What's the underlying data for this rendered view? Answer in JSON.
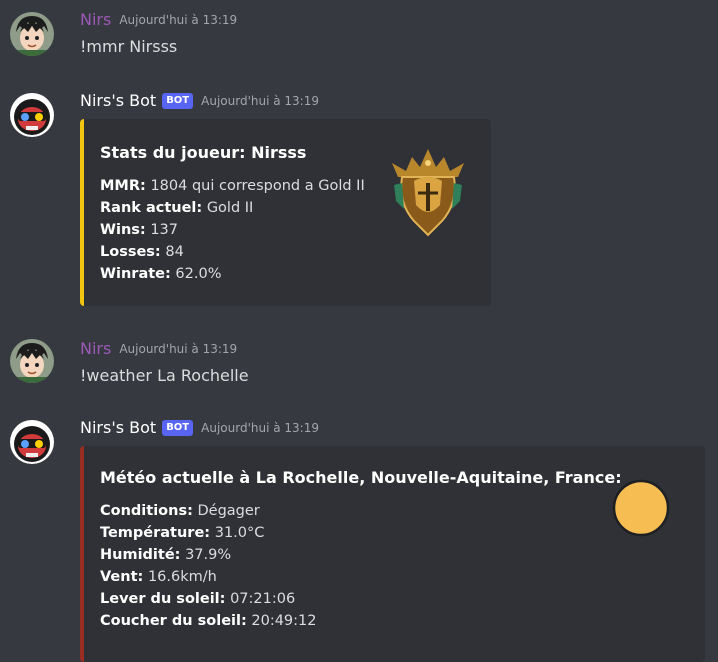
{
  "messages": [
    {
      "author": "Nirs",
      "timestamp": "Aujourd'hui à 13:19",
      "text": "!mmr Nirsss"
    },
    {
      "author": "Nirs's Bot",
      "bot_tag": "BOT",
      "timestamp": "Aujourd'hui à 13:19",
      "embed": {
        "accent_color": "#f1c40f",
        "title": "Stats du joueur: Nirsss",
        "fields": [
          {
            "label": "MMR:",
            "value": "1804 qui correspond a Gold II"
          },
          {
            "label": "Rank actuel:",
            "value": "Gold II"
          },
          {
            "label": "Wins:",
            "value": "137"
          },
          {
            "label": "Losses:",
            "value": "84"
          },
          {
            "label": "Winrate:",
            "value": "62.0%"
          }
        ],
        "thumbnail_icon": "gold-rank-emblem-icon"
      }
    },
    {
      "author": "Nirs",
      "timestamp": "Aujourd'hui à 13:19",
      "text": "!weather La Rochelle"
    },
    {
      "author": "Nirs's Bot",
      "bot_tag": "BOT",
      "timestamp": "Aujourd'hui à 13:19",
      "embed": {
        "accent_color": "#992d22",
        "title": "Météo actuelle à La Rochelle, Nouvelle-Aquitaine, France:",
        "fields": [
          {
            "label": "Conditions:",
            "value": "Dégager"
          },
          {
            "label": "Température:",
            "value": "31.0°C"
          },
          {
            "label": "Humidité:",
            "value": "37.9%"
          },
          {
            "label": "Vent:",
            "value": "16.6km/h"
          },
          {
            "label": "Lever du soleil:",
            "value": "07:21:06"
          },
          {
            "label": "Coucher du soleil:",
            "value": "20:49:12"
          }
        ],
        "thumbnail_icon": "sun-icon"
      }
    }
  ]
}
